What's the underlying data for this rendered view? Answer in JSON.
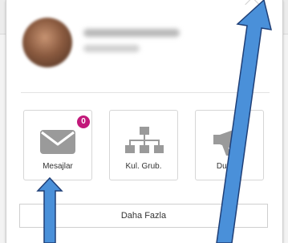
{
  "apps": [
    {
      "label": "Mesajlar",
      "icon": "envelope-icon",
      "badge": "0"
    },
    {
      "label": "Kul. Grub.",
      "icon": "org-chart-icon"
    },
    {
      "label": "Duyuru",
      "icon": "megaphone-icon"
    }
  ],
  "more_button_label": "Daha Fazla",
  "colors": {
    "icon": "#9a9a9a",
    "badge": "#c2187a",
    "arrow": "#4a90d9",
    "arrow_outline": "#1f3f77"
  }
}
